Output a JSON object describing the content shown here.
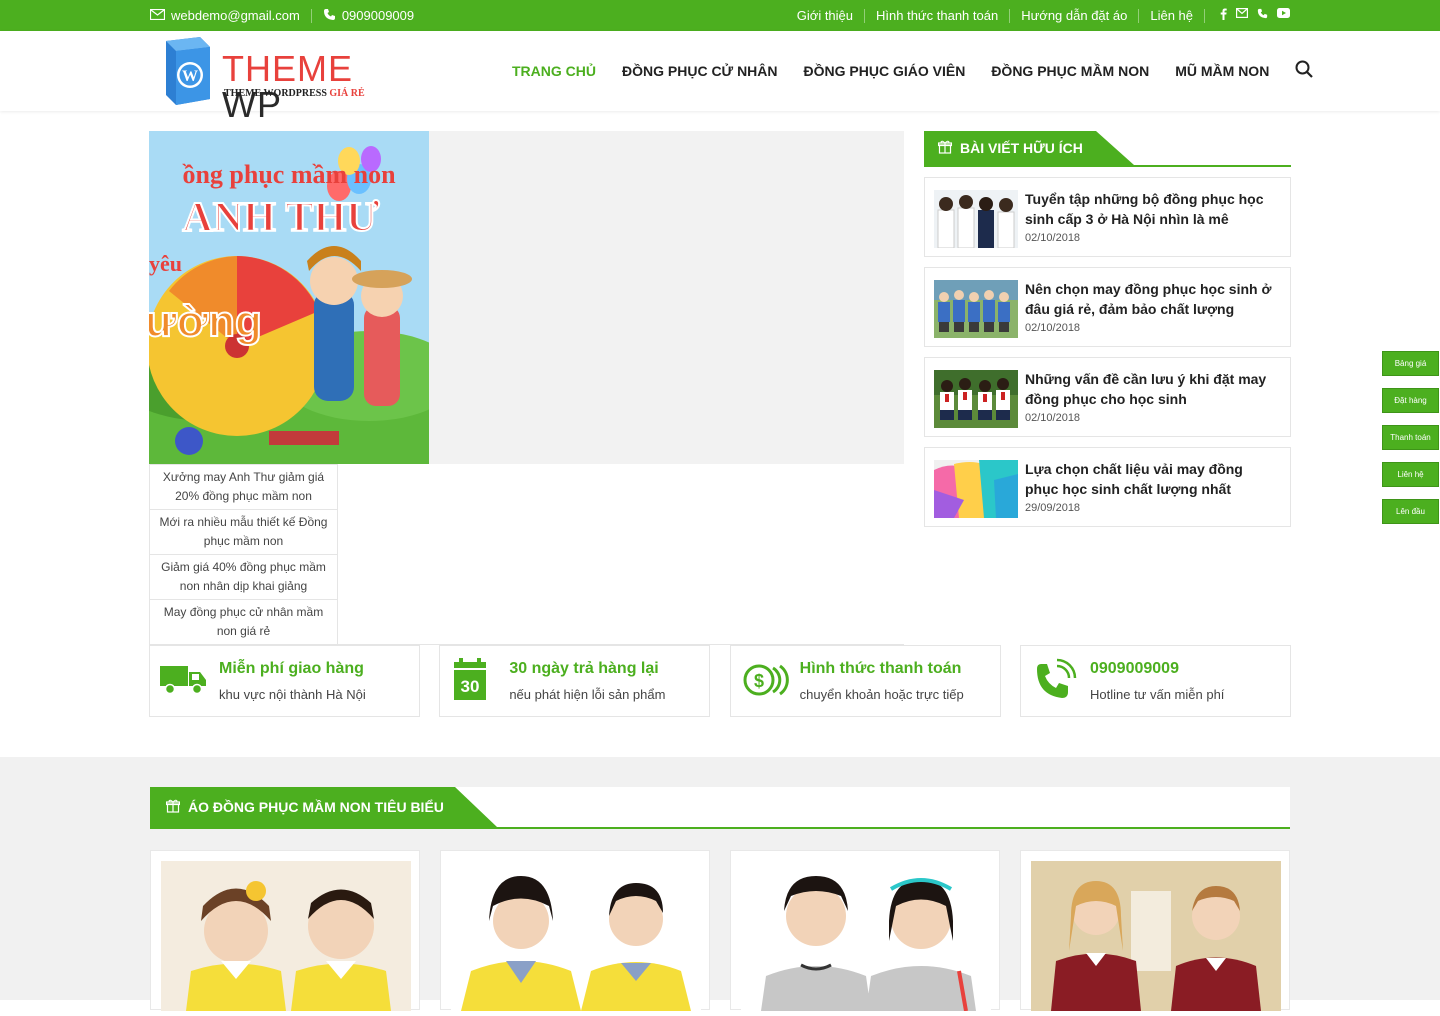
{
  "topbar": {
    "email": "webdemo@gmail.com",
    "phone": "0909009009",
    "links": [
      "Giới thiệu",
      "Hình thức thanh toán",
      "Hướng dẫn đặt áo",
      "Liên hệ"
    ],
    "social_icons": [
      "facebook-icon",
      "mail-icon",
      "phone-icon",
      "youtube-icon"
    ]
  },
  "logo": {
    "title": "THEME ",
    "title_accent": "WP",
    "subtitle": "THEME WORDPRESS ",
    "subtitle_accent": "GIÁ RẺ"
  },
  "nav": {
    "items": [
      "TRANG CHỦ",
      "ĐỒNG PHỤC CỬ NHÂN",
      "ĐỒNG PHỤC GIÁO VIÊN",
      "ĐỒNG PHỤC MẦM NON",
      "MŨ MẦM NON"
    ],
    "active_index": 0
  },
  "slider": {
    "image_text_1": "ồng phục mầm non",
    "image_text_2": "ANH THƯ",
    "image_text_3": "yêu",
    "image_text_4": "ường",
    "thumbs": [
      "Xưởng may Anh Thư giảm giá 20% đồng phục mầm non",
      "Mới ra nhiều mẫu thiết kế Đồng phục mầm non",
      "Giảm giá 40% đồng phục mầm non nhân dịp khai giảng",
      "May đồng phục cử nhân mầm non giá rẻ"
    ]
  },
  "sidebar": {
    "heading": "BÀI VIẾT HỮU ÍCH",
    "posts": [
      {
        "title": "Tuyển tập những bộ đồng phục học sinh cấp 3 ở Hà Nội nhìn là mê",
        "date": "02/10/2018"
      },
      {
        "title": "Nên chọn may đồng phục học sinh ở đâu giá rẻ, đảm bảo chất lượng",
        "date": "02/10/2018"
      },
      {
        "title": "Những vấn đề cần lưu ý khi đặt may đồng phục cho học sinh",
        "date": "02/10/2018"
      },
      {
        "title": "Lựa chọn chất liệu vải may đồng phục học sinh chất lượng nhất",
        "date": "29/09/2018"
      }
    ]
  },
  "features": [
    {
      "title": "Miễn phí giao hàng",
      "sub": "khu vực nội thành Hà Nội",
      "icon": "truck-icon"
    },
    {
      "title": "30 ngày trả hàng lại",
      "sub": "nếu phát hiện lỗi sản phẩm",
      "icon": "calendar-30-icon",
      "icon_text": "30"
    },
    {
      "title": "Hình thức thanh toán",
      "sub": "chuyển khoản hoặc trực tiếp",
      "icon": "coins-icon"
    },
    {
      "title": "0909009009",
      "sub": "Hotline tư vấn miễn phí",
      "icon": "phone-ring-icon"
    }
  ],
  "featured_section": {
    "heading": "ÁO ĐỒNG PHỤC MẦM NON TIÊU BIỂU"
  },
  "fixed_buttons": [
    "Bảng giá",
    "Đặt hàng",
    "Thanh toán",
    "Liên hệ",
    "Lên đầu"
  ],
  "colors": {
    "brand_green": "#4caf1f",
    "logo_red": "#e8413c"
  }
}
